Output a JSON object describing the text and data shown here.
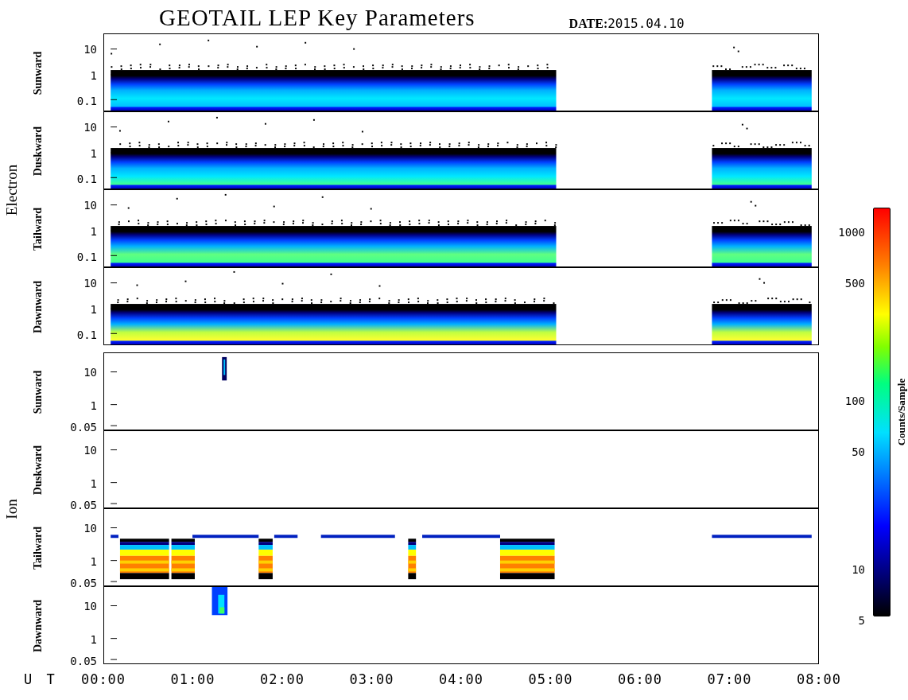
{
  "title": "GEOTAIL LEP Key Parameters",
  "date": {
    "label": "DATE:",
    "value": "2015.04.10"
  },
  "groups": [
    {
      "name": "Electron",
      "panels": [
        {
          "name": "Sunward",
          "yticks": [
            "10",
            "1",
            "0.1"
          ]
        },
        {
          "name": "Duskward",
          "yticks": [
            "10",
            "1",
            "0.1"
          ]
        },
        {
          "name": "Tailward",
          "yticks": [
            "10",
            "1",
            "0.1"
          ]
        },
        {
          "name": "Dawnward",
          "yticks": [
            "10",
            "1",
            "0.1"
          ]
        }
      ]
    },
    {
      "name": "Ion",
      "panels": [
        {
          "name": "Sunward",
          "yticks": [
            "10",
            "1",
            "0.05"
          ]
        },
        {
          "name": "Duskward",
          "yticks": [
            "10",
            "1",
            "0.05"
          ]
        },
        {
          "name": "Tailward",
          "yticks": [
            "10",
            "1",
            "0.05"
          ]
        },
        {
          "name": "Dawnward",
          "yticks": [
            "10",
            "1",
            "0.05"
          ]
        }
      ]
    }
  ],
  "colorbar": {
    "label": "Counts/Sample",
    "ticks": [
      "1000",
      "500",
      "100",
      "50",
      "10",
      "5"
    ]
  },
  "x_axis": {
    "label": "U T",
    "ticks": [
      "00:00",
      "01:00",
      "02:00",
      "03:00",
      "04:00",
      "05:00",
      "06:00",
      "07:00",
      "08:00"
    ]
  }
}
